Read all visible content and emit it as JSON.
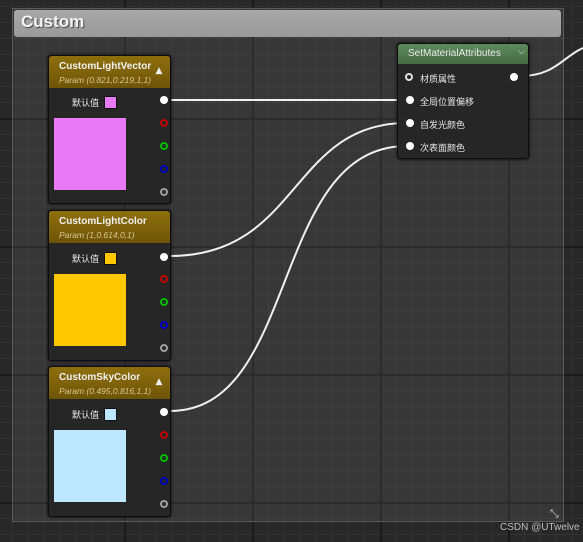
{
  "comment": {
    "title": "Custom"
  },
  "nodes": [
    {
      "name": "CustomLightVector",
      "subtitle": "Param (0.821,0.219,1,1)",
      "default_label": "默认值",
      "color": "#e87bf5"
    },
    {
      "name": "CustomLightColor",
      "subtitle": "Param (1,0.614,0,1)",
      "default_label": "默认值",
      "color": "#ffc800"
    },
    {
      "name": "CustomSkyColor",
      "subtitle": "Param (0.495,0.816,1,1)",
      "default_label": "默认值",
      "color": "#bde6ff"
    }
  ],
  "set_material_attributes": {
    "title": "SetMaterialAttributes",
    "inputs": [
      "材质属性",
      "全局位置偏移",
      "自发光颜色",
      "次表面颜色"
    ]
  },
  "pin_colors": {
    "rgba": "#ffffff",
    "r": "#c00000",
    "g": "#00c000",
    "b": "#0000c0",
    "a": "#a0a0a0"
  },
  "icons": {
    "collapse": "chevron-up-icon",
    "sma_collapse": "chevron-down-icon",
    "resize": "resize-grip-icon"
  },
  "watermark": "CSDN @UTwelve"
}
